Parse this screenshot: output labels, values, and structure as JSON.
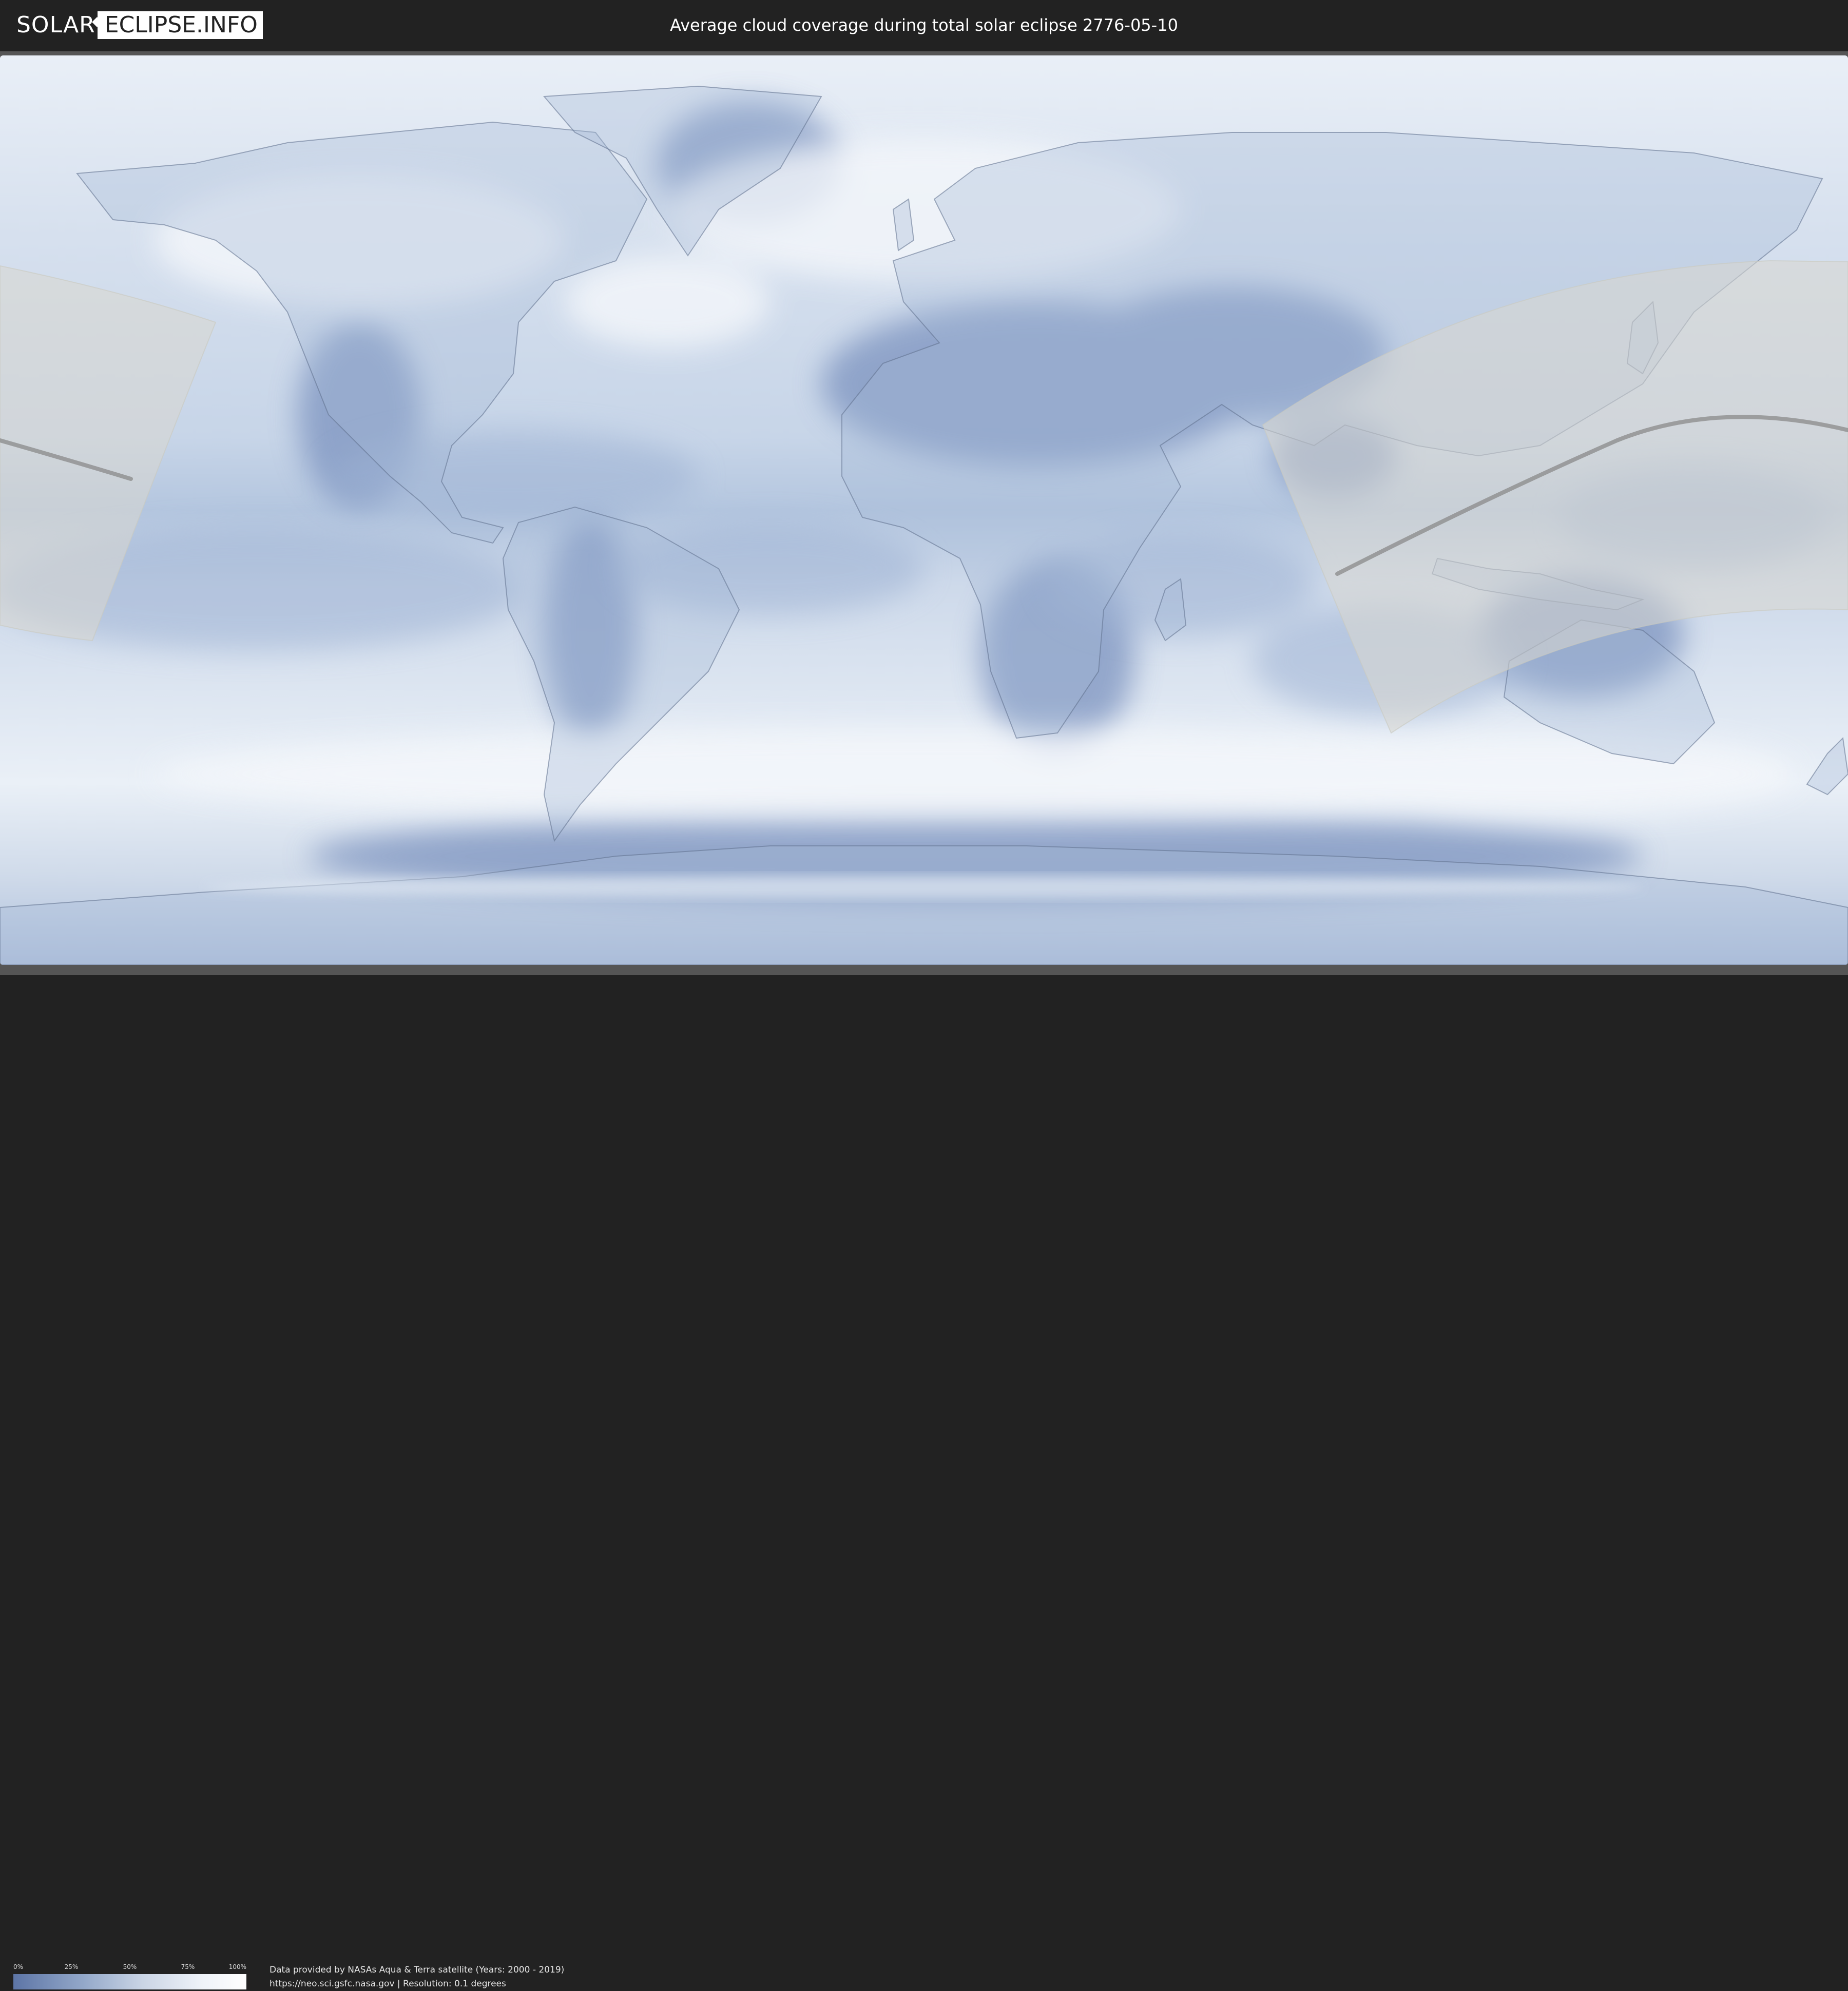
{
  "header": {
    "logo": {
      "part1": "SOLAR",
      "part2": "ECLIPSE.INFO"
    },
    "title": "Average cloud coverage during total solar eclipse 2776-05-10"
  },
  "legend": {
    "ticks": [
      "0%",
      "25%",
      "50%",
      "75%",
      "100%"
    ],
    "colors": {
      "low": "#5d75a6",
      "high": "#ffffff"
    }
  },
  "credits": {
    "line1": "Data provided by NASAs Aqua & Terra satellite (Years: 2000 - 2019)",
    "line2": "https://neo.sci.gsfc.nasa.gov | Resolution: 0.1 degrees"
  },
  "map": {
    "colors": {
      "cloud_high": "#eef3f9",
      "cloud_low": "#6e88b5",
      "penumbra": "#d9d9d2",
      "path": "#888888",
      "border": "#6a7a95"
    }
  }
}
